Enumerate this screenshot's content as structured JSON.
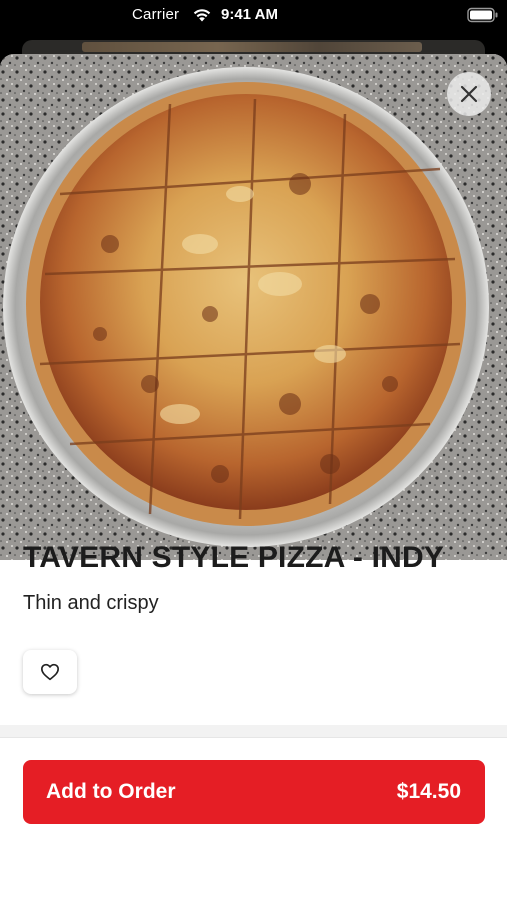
{
  "status_bar": {
    "carrier": "Carrier",
    "time": "9:41 AM",
    "wifi_icon": "wifi-icon",
    "battery_icon": "battery-icon"
  },
  "item": {
    "image_alt": "pizza-photo",
    "title": "TAVERN STYLE PIZZA - INDY",
    "description": "Thin and crispy"
  },
  "actions": {
    "close_icon": "close-icon",
    "favorite_icon": "heart-icon",
    "add_to_order_label": "Add to Order",
    "price": "$14.50"
  },
  "colors": {
    "accent": "#e51e25",
    "background": "#ffffff",
    "text": "#1c1c1c"
  }
}
